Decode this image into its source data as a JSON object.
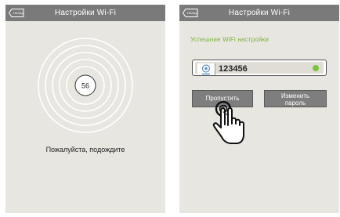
{
  "left_screen": {
    "header": {
      "back_label": "НАЗАД",
      "title": "Настройки Wi-Fi"
    },
    "countdown": "56",
    "wait_message": "Пожалуйста, подождите"
  },
  "right_screen": {
    "header": {
      "back_label": "НАЗАД",
      "title": "Настройки Wi-Fi"
    },
    "success_message": "Успешние WiFi настройки",
    "password": {
      "icon": "wifi-camera-icon",
      "value": "123456",
      "status": "connected",
      "status_color": "#7cc43a"
    },
    "buttons": {
      "skip": "Пропустить",
      "change_password_line1": "Изменить",
      "change_password_line2": "пароль"
    }
  },
  "colors": {
    "header": "#7a7a7a",
    "background": "#e8e6e0",
    "success": "#7cb342",
    "button": "#7e7e7e"
  }
}
